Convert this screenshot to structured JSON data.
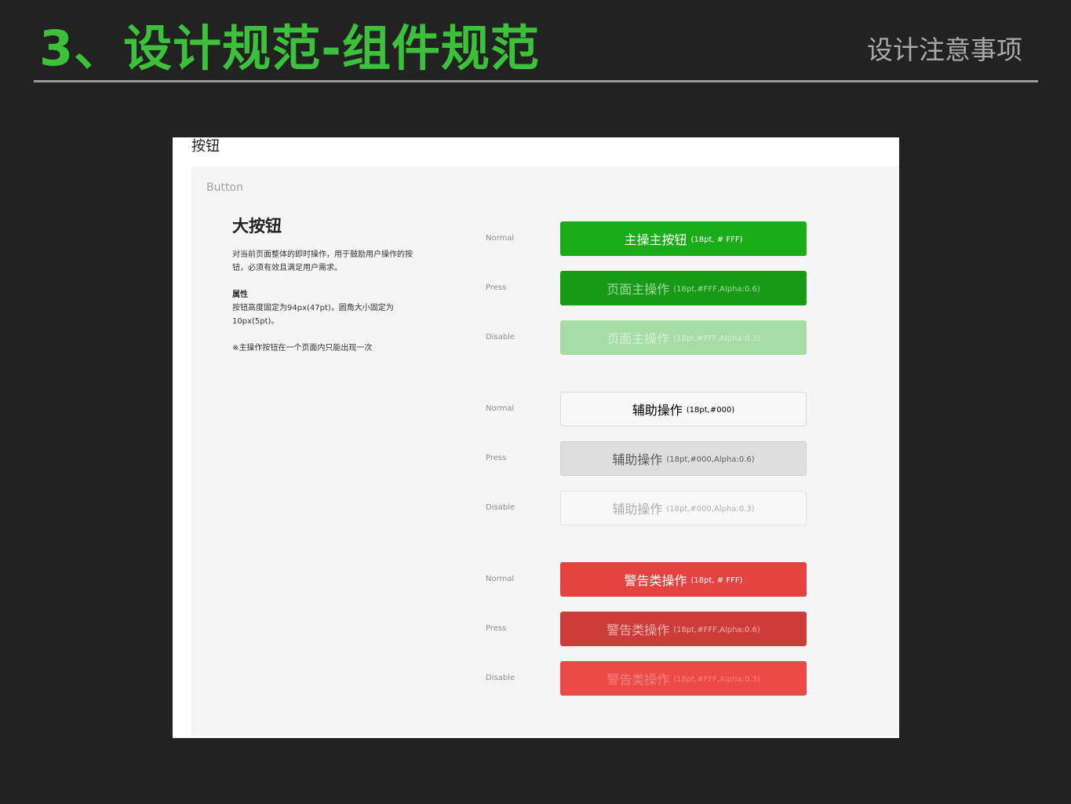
{
  "slide": {
    "title": "3、设计规范-组件规范",
    "subtitle": "设计注意事项",
    "title_color": "#3cc23a"
  },
  "panel": {
    "heading": "按钮",
    "section_label": "Button",
    "component_title": "大按钮",
    "description": "对当前页面整体的即时操作，用于鼓励用户操作的按钮，必须有效且满足用户需求。",
    "attr_title": "属性",
    "attr_text": "按钮高度固定为94px(47pt)，圆角大小固定为10px(5pt)。",
    "note": "※主操作按钮在一个页面内只能出现一次"
  },
  "button_groups": [
    {
      "group": "primary",
      "states": [
        {
          "state": "Normal",
          "label": "主操主按钮",
          "note": "(18pt, # FFF)",
          "color": "#1aad19"
        },
        {
          "state": "Press",
          "label": "页面主操作",
          "note": "(18pt,#FFF,Alpha:0.6)",
          "color": "#179b16"
        },
        {
          "state": "Disable",
          "label": "页面主操作",
          "note": "(18pt,#FFF,Alpha:0.3)",
          "color": "#a7dca7"
        }
      ]
    },
    {
      "group": "secondary",
      "states": [
        {
          "state": "Normal",
          "label": "辅助操作",
          "note": "(18pt,#000)",
          "color": "#f8f8f8"
        },
        {
          "state": "Press",
          "label": "辅助操作",
          "note": "(18pt,#000,Alpha:0.6)",
          "color": "#dedede"
        },
        {
          "state": "Disable",
          "label": "辅助操作",
          "note": "(18pt,#000,Alpha:0.3)",
          "color": "#f8f8f8"
        }
      ]
    },
    {
      "group": "warning",
      "states": [
        {
          "state": "Normal",
          "label": "警告类操作",
          "note": "(18pt, # FFF)",
          "color": "#e64340"
        },
        {
          "state": "Press",
          "label": "警告类操作",
          "note": "(18pt,#FFF,Alpha:0.6)",
          "color": "#ce3c39"
        },
        {
          "state": "Disable",
          "label": "警告类操作",
          "note": "(18pt,#FFF,Alpha:0.3)",
          "color": "#ec4a47"
        }
      ]
    }
  ]
}
